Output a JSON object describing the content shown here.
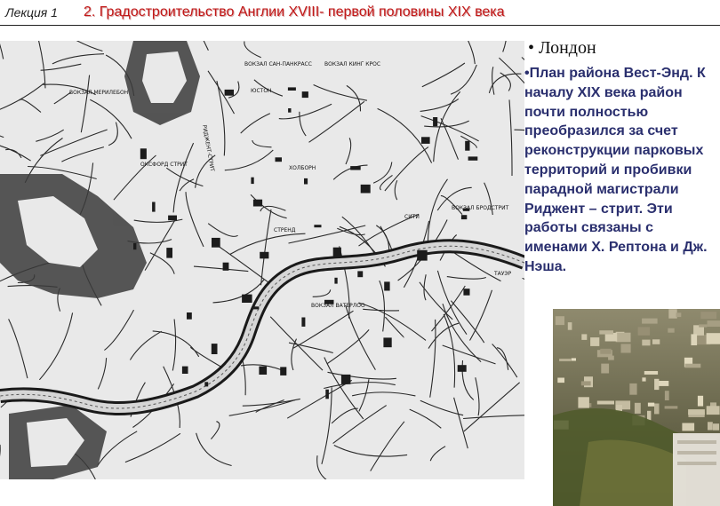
{
  "header": {
    "lecture": "Лекция 1",
    "title": "2. Градостроительство Англии XVIII- первой половины XIX века"
  },
  "sidebar": {
    "heading": "• Лондон",
    "body": "•План района Вест-Энд. К началу XIX века район почти полностью преобразился за счет реконструкции парковых территорий и пробивки парадной магистрали Риджент – стрит. Эти работы связаны с именами Х. Рептона и Дж. Нэша."
  },
  "map": {
    "labels": [
      "ВОКЗАЛ МЕРИЛЕБОН",
      "ВОКЗАЛ САН-ПАНКРАСС",
      "ВОКЗАЛ КИНГ КРОС",
      "ЮСТОН",
      "ОКСФОРД СТРИТ",
      "ХОЛБОРН",
      "ВОКЗАЛ БРОДСТРИТ",
      "СИТИ",
      "СТРЕНД",
      "ВОКЗАЛ ВАТЕРЛОО",
      "ТАУЭР",
      "РИДЖЕНТ-СТРИТ"
    ]
  },
  "colors": {
    "title_red": "#c21818",
    "body_blue": "#2a2f6e",
    "map_paper": "#e9e9e9",
    "map_ink": "#222222"
  }
}
